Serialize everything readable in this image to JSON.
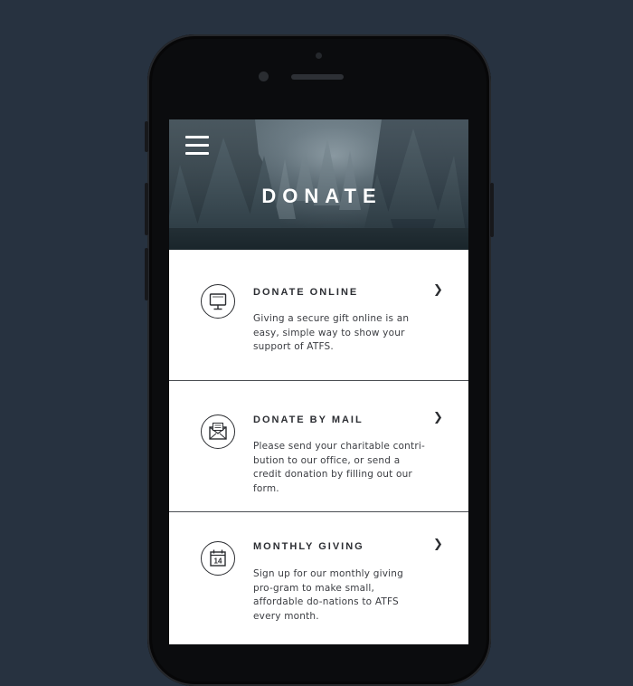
{
  "header": {
    "title": "DONATE"
  },
  "items": [
    {
      "title": "DONATE ONLINE",
      "description": "Giving a secure gift online is an easy, simple way to show your support of ATFS.",
      "icon": "computer-monitor-icon"
    },
    {
      "title": "DONATE BY MAIL",
      "description": "Please send your charitable contri-bution to our office, or send a credit donation by filling out our form.",
      "icon": "mail-envelope-icon"
    },
    {
      "title": "MONTHLY GIVING",
      "description": "Sign up for our monthly giving pro-gram to make small, affordable do-nations to ATFS every month.",
      "icon": "calendar-icon",
      "calendar_day": "14"
    }
  ],
  "colors": {
    "background": "#273240",
    "phone": "#0b0c0e",
    "text": "#2c2e33",
    "divider": "#4a4d52"
  }
}
